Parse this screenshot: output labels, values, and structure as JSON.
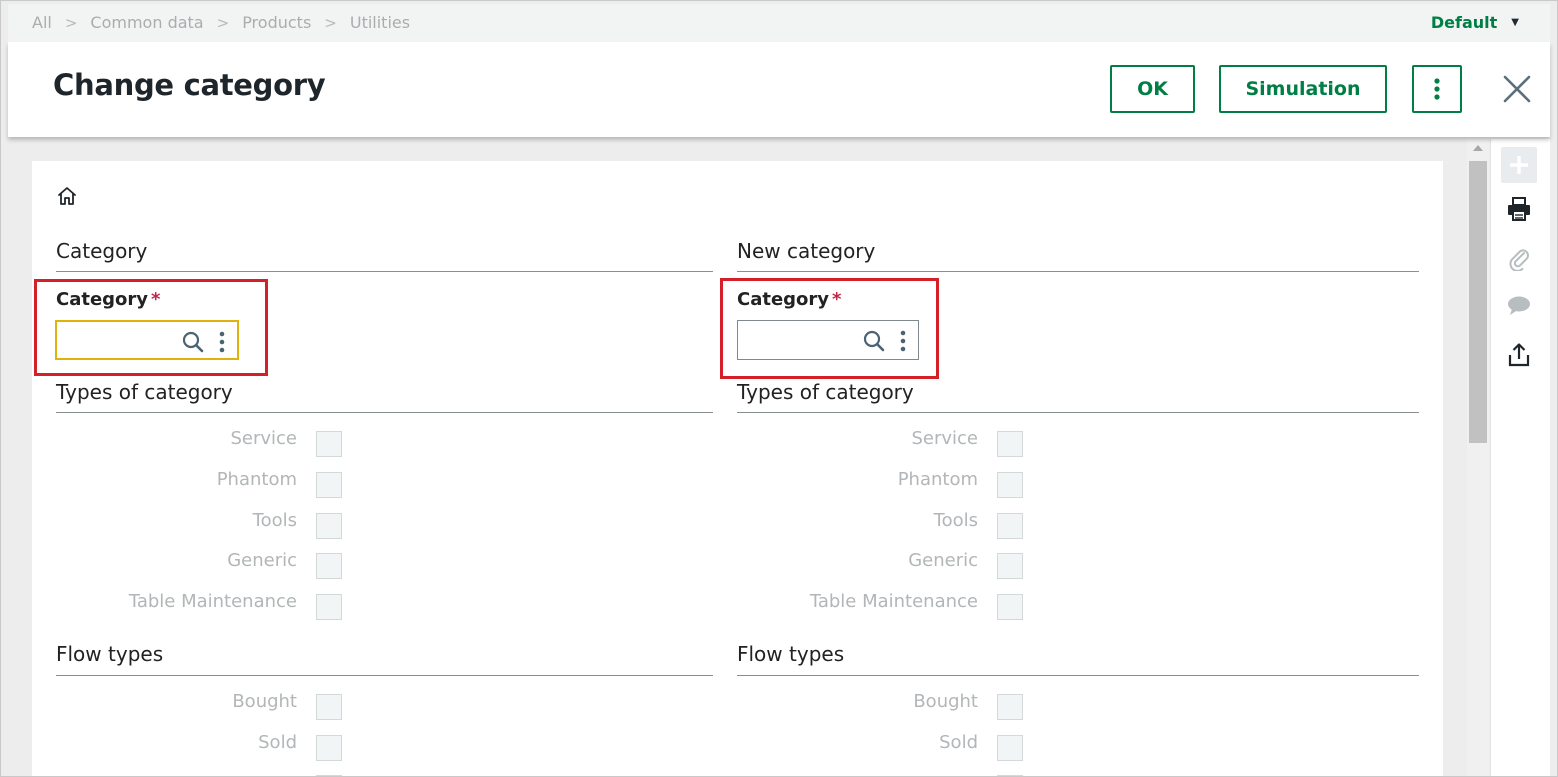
{
  "breadcrumb": {
    "items": [
      "All",
      "Common data",
      "Products",
      "Utilities"
    ],
    "separator": ">"
  },
  "folder": {
    "label": "Default",
    "caret": "▼"
  },
  "header": {
    "title": "Change category",
    "ok_label": "OK",
    "simulation_label": "Simulation"
  },
  "left": {
    "section_title": "Category",
    "field_label": "Category",
    "required_mark": "*",
    "field_value": "",
    "types_title": "Types of category",
    "types": [
      "Service",
      "Phantom",
      "Tools",
      "Generic",
      "Table Maintenance"
    ],
    "flow_title": "Flow types",
    "flows": [
      "Bought",
      "Sold"
    ]
  },
  "right": {
    "section_title": "New category",
    "field_label": "Category",
    "required_mark": "*",
    "field_value": "",
    "types_title": "Types of category",
    "types": [
      "Service",
      "Phantom",
      "Tools",
      "Generic",
      "Table Maintenance"
    ],
    "flow_title": "Flow types",
    "flows": [
      "Bought",
      "Sold"
    ]
  },
  "icons": {
    "home": "home-icon",
    "search": "search-icon",
    "more": "more-vertical-icon",
    "close": "close-icon",
    "rail": [
      "plus-icon",
      "print-icon",
      "paperclip-icon",
      "comment-icon",
      "export-icon"
    ]
  },
  "colors": {
    "accent": "#007e45",
    "required": "#c02648",
    "highlight": "#d42028",
    "focus": "#e0b20b"
  }
}
